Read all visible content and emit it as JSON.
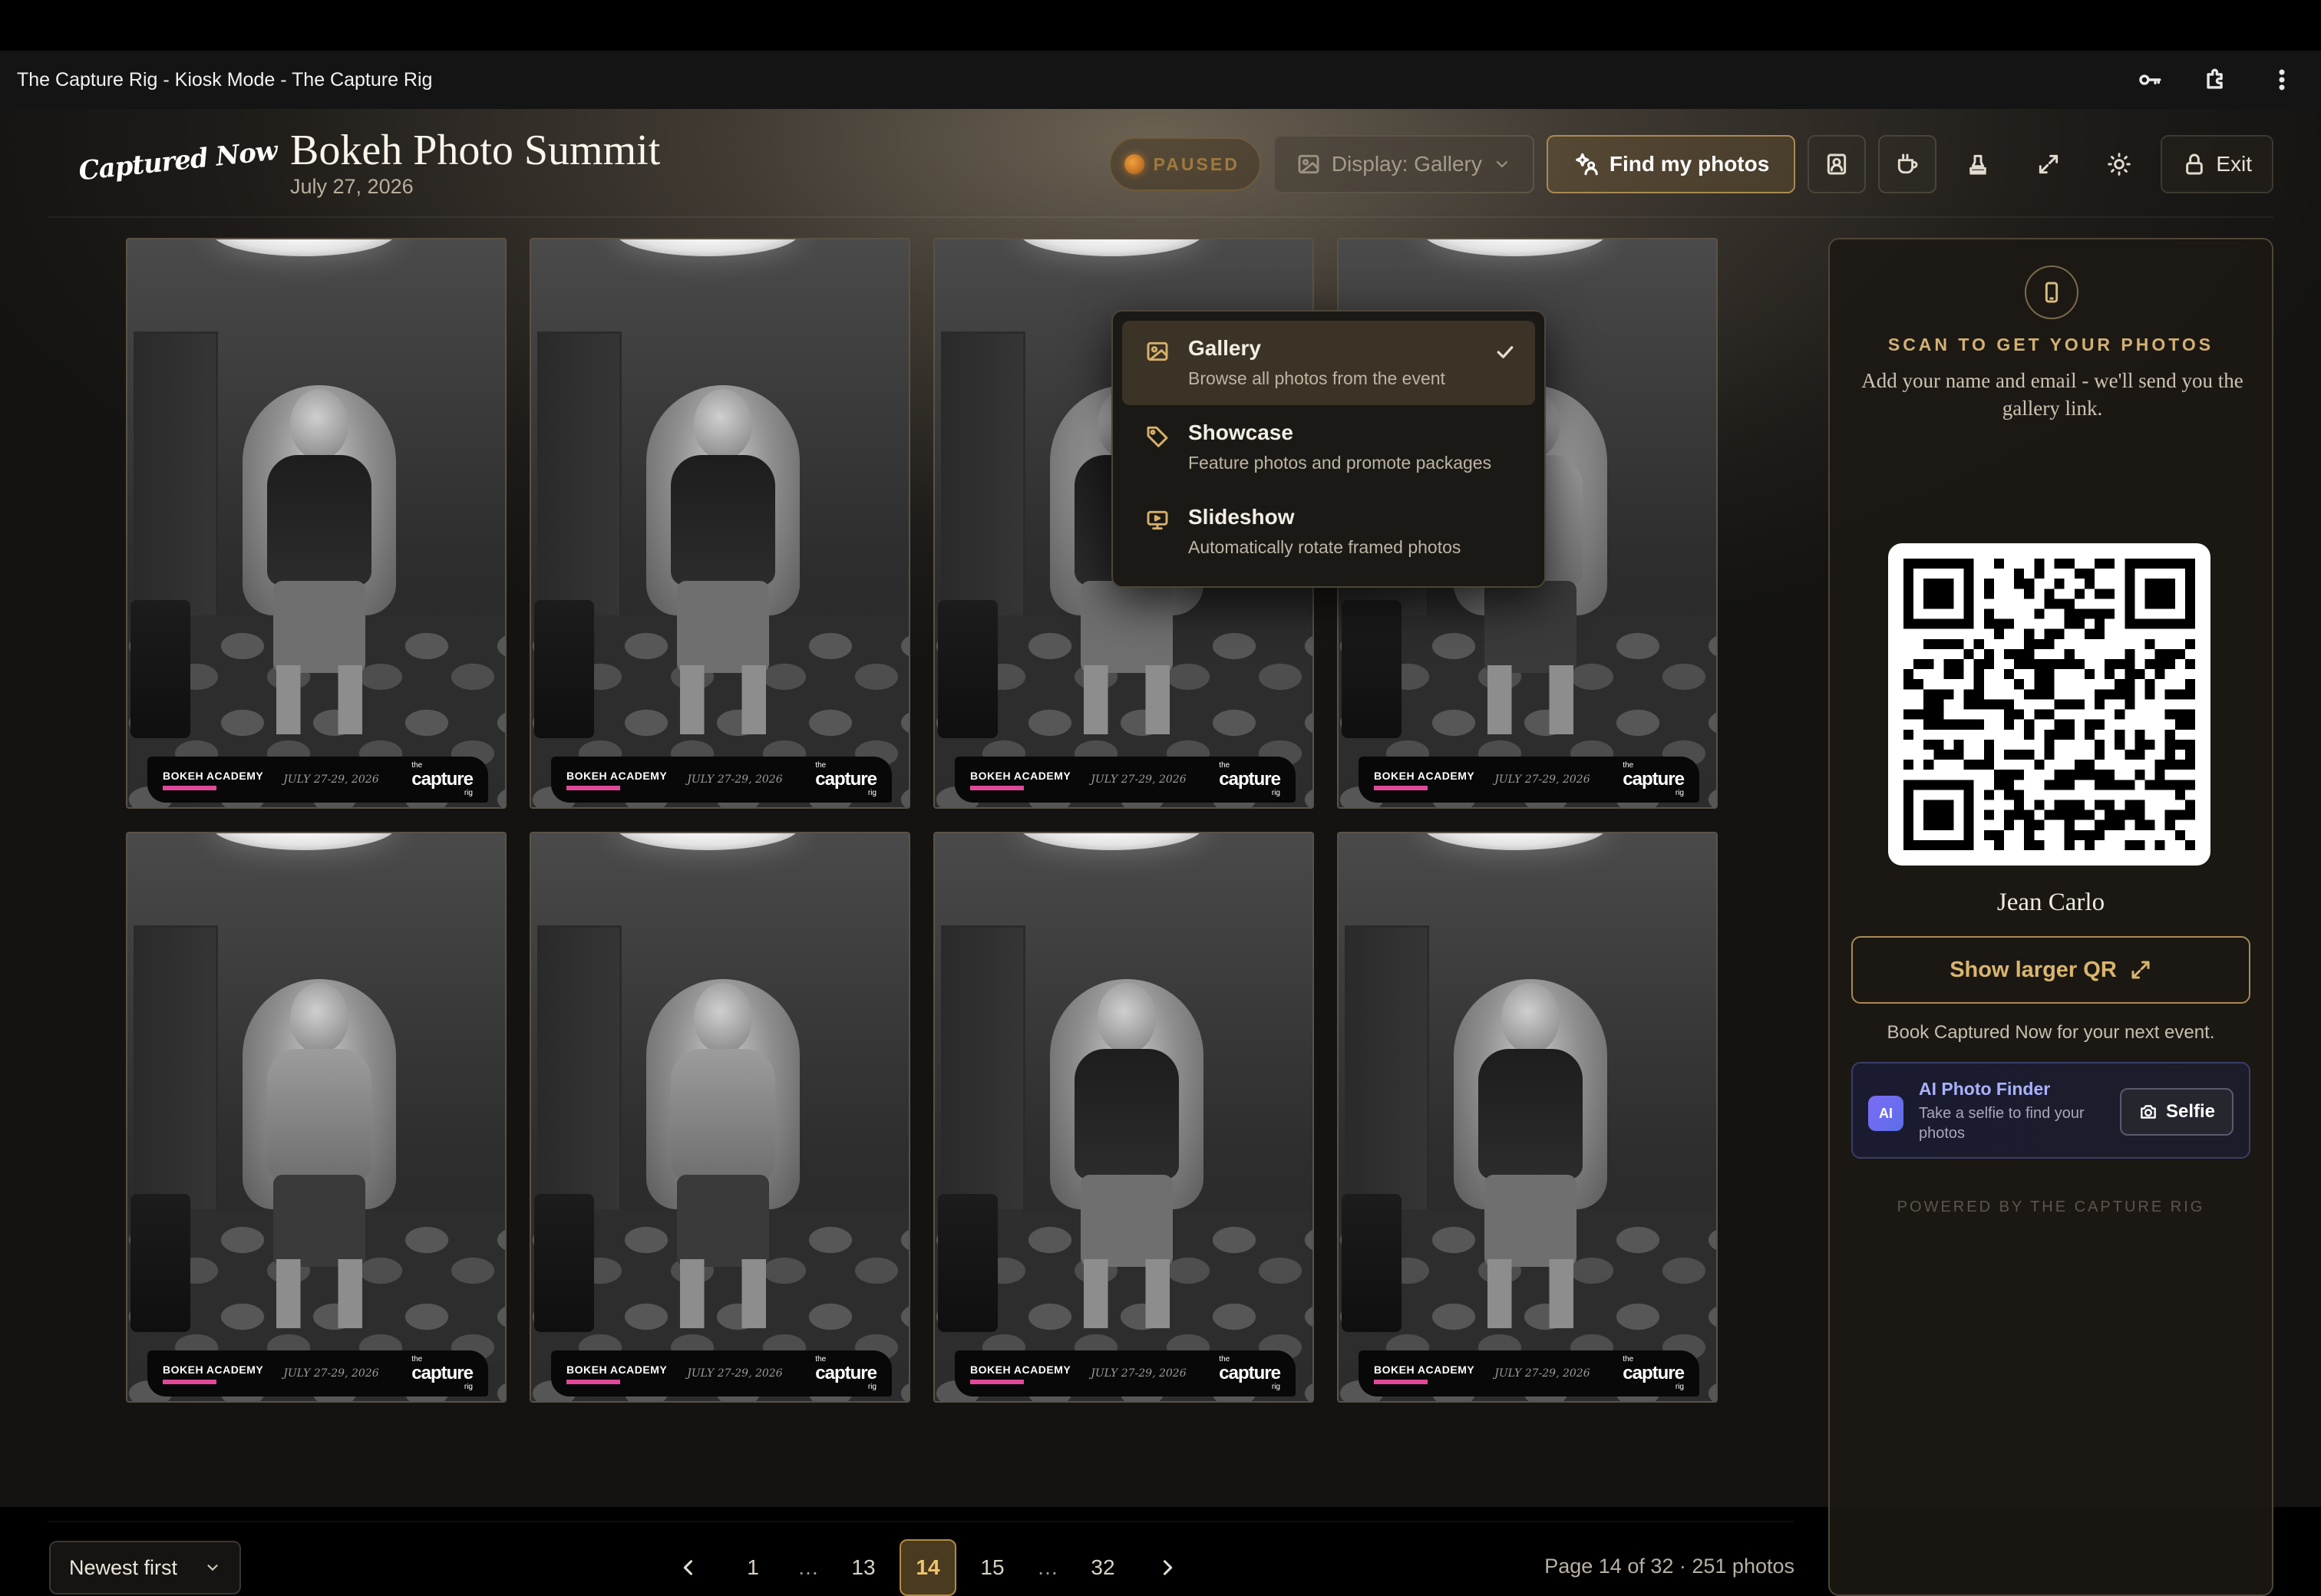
{
  "window": {
    "title": "The Capture Rig - Kiosk Mode - The Capture Rig"
  },
  "header": {
    "brand": "Captured Now",
    "event_title": "Bokeh Photo Summit",
    "event_date": "July 27, 2026"
  },
  "toolbar": {
    "status": "PAUSED",
    "display_label": "Display: Gallery",
    "find_label": "Find my photos",
    "exit_label": "Exit"
  },
  "display_menu": {
    "items": [
      {
        "title": "Gallery",
        "description": "Browse all photos from the event",
        "selected": true
      },
      {
        "title": "Showcase",
        "description": "Feature photos and promote packages",
        "selected": false
      },
      {
        "title": "Slideshow",
        "description": "Automatically rotate framed photos",
        "selected": false
      }
    ]
  },
  "photo_banner": {
    "org": "BOKEH ACADEMY",
    "dates": "JULY 27-29, 2026",
    "brand": "capture",
    "brand_prefix": "the",
    "brand_suffix": "rig"
  },
  "panel": {
    "scan_heading": "SCAN TO GET YOUR PHOTOS",
    "scan_text": "Add your name and email - we'll send you the gallery link.",
    "person_name": "Jean Carlo",
    "larger_qr_label": "Show larger QR",
    "book_text": "Book Captured Now for your next event.",
    "ai": {
      "badge": "AI",
      "title": "AI Photo Finder",
      "description": "Take a selfie to find your photos",
      "button_label": "Selfie"
    },
    "powered": "POWERED BY THE CAPTURE RIG"
  },
  "footer": {
    "sort_label": "Newest first",
    "pages": [
      "1",
      "…",
      "13",
      "14",
      "15",
      "…",
      "32"
    ],
    "current_page": "14",
    "page_info": "Page 14 of 32 · 251 photos"
  },
  "colors": {
    "accent": "#d9b56e",
    "paused": "#a07a3c",
    "ai_accent": "#a9b2ff"
  }
}
